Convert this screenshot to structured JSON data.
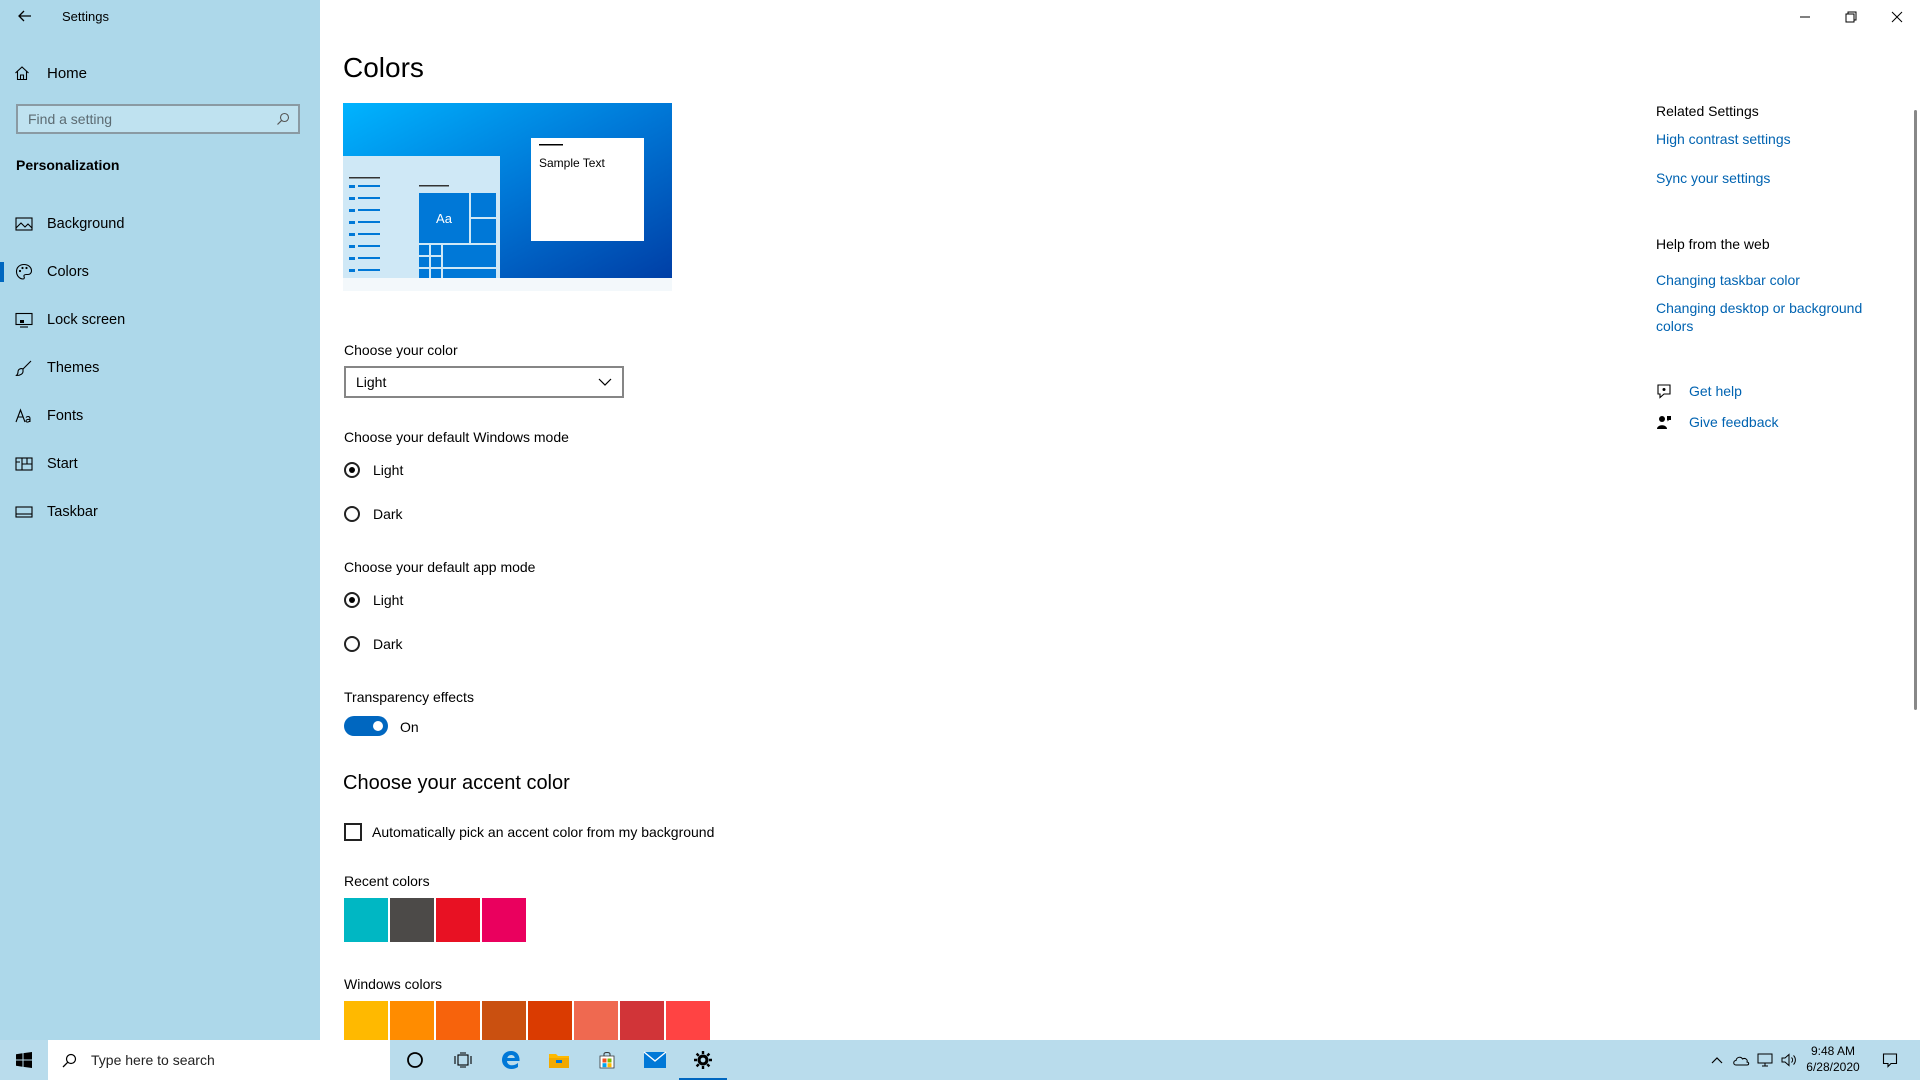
{
  "window": {
    "title": "Settings",
    "controls": [
      "minimize-icon",
      "restore-icon",
      "close-icon"
    ]
  },
  "sidebar": {
    "home_label": "Home",
    "search_placeholder": "Find a setting",
    "section_title": "Personalization",
    "items": [
      {
        "label": "Background",
        "icon": "picture-icon",
        "active": false
      },
      {
        "label": "Colors",
        "icon": "palette-icon",
        "active": true
      },
      {
        "label": "Lock screen",
        "icon": "lock-screen-icon",
        "active": false
      },
      {
        "label": "Themes",
        "icon": "brush-icon",
        "active": false
      },
      {
        "label": "Fonts",
        "icon": "font-icon",
        "active": false
      },
      {
        "label": "Start",
        "icon": "start-menu-icon",
        "active": false
      },
      {
        "label": "Taskbar",
        "icon": "taskbar-icon",
        "active": false
      }
    ]
  },
  "main": {
    "title": "Colors",
    "preview": {
      "sample_text": "Sample Text",
      "tile_text": "Aa",
      "accent": "#0078d7"
    },
    "choose_color": {
      "label": "Choose your color",
      "value": "Light"
    },
    "windows_mode": {
      "label": "Choose your default Windows mode",
      "options": [
        "Light",
        "Dark"
      ],
      "selected": "Light"
    },
    "app_mode": {
      "label": "Choose your default app mode",
      "options": [
        "Light",
        "Dark"
      ],
      "selected": "Light"
    },
    "transparency": {
      "label": "Transparency effects",
      "state": "On"
    },
    "accent": {
      "title": "Choose your accent color",
      "auto_pick_label": "Automatically pick an accent color from my background",
      "auto_pick_checked": false,
      "recent_label": "Recent colors",
      "recent_colors": [
        "#00b7c3",
        "#4c4a48",
        "#e81123",
        "#ea005e"
      ],
      "windows_label": "Windows colors",
      "windows_colors": [
        "#ffb900",
        "#ff8c00",
        "#f7630c",
        "#ca5010",
        "#da3b01",
        "#ef6950",
        "#d13438",
        "#ff4343"
      ]
    }
  },
  "right": {
    "related_title": "Related Settings",
    "related_links": [
      "High contrast settings",
      "Sync your settings"
    ],
    "help_title": "Help from the web",
    "help_links": [
      "Changing taskbar color",
      "Changing desktop or background colors"
    ],
    "get_help": "Get help",
    "give_feedback": "Give feedback"
  },
  "taskbar": {
    "search_placeholder": "Type here to search",
    "time": "9:48 AM",
    "date": "6/28/2020",
    "apps": [
      "cortana-icon",
      "task-view-icon",
      "edge-icon",
      "file-explorer-icon",
      "store-icon",
      "mail-icon",
      "settings-gear-icon"
    ]
  }
}
